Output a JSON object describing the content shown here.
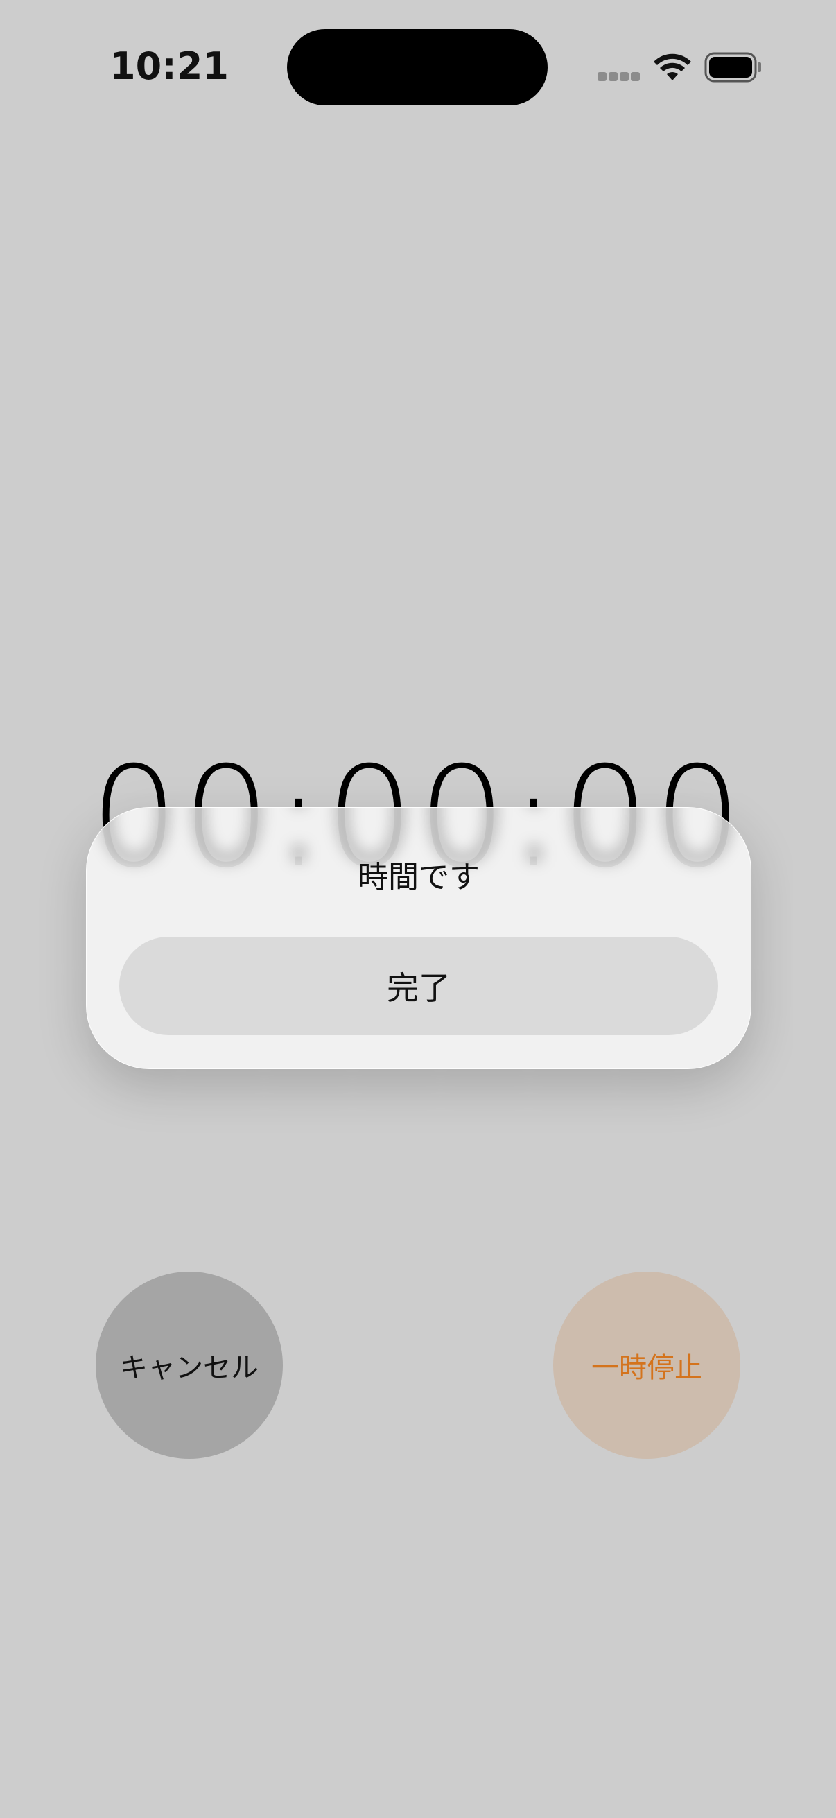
{
  "status_bar": {
    "time": "10:21",
    "icons": [
      "signal-icon",
      "wifi-icon",
      "battery-icon"
    ]
  },
  "timer": {
    "display": "00:00:00"
  },
  "alert": {
    "title": "時間です",
    "done_label": "完了"
  },
  "controls": {
    "cancel_label": "キャンセル",
    "pause_label": "一時停止"
  },
  "colors": {
    "background": "#cdcdcd",
    "accent": "#d4731c",
    "cancel_bg": "#a5a5a5",
    "pause_bg": "#cdbcad"
  }
}
